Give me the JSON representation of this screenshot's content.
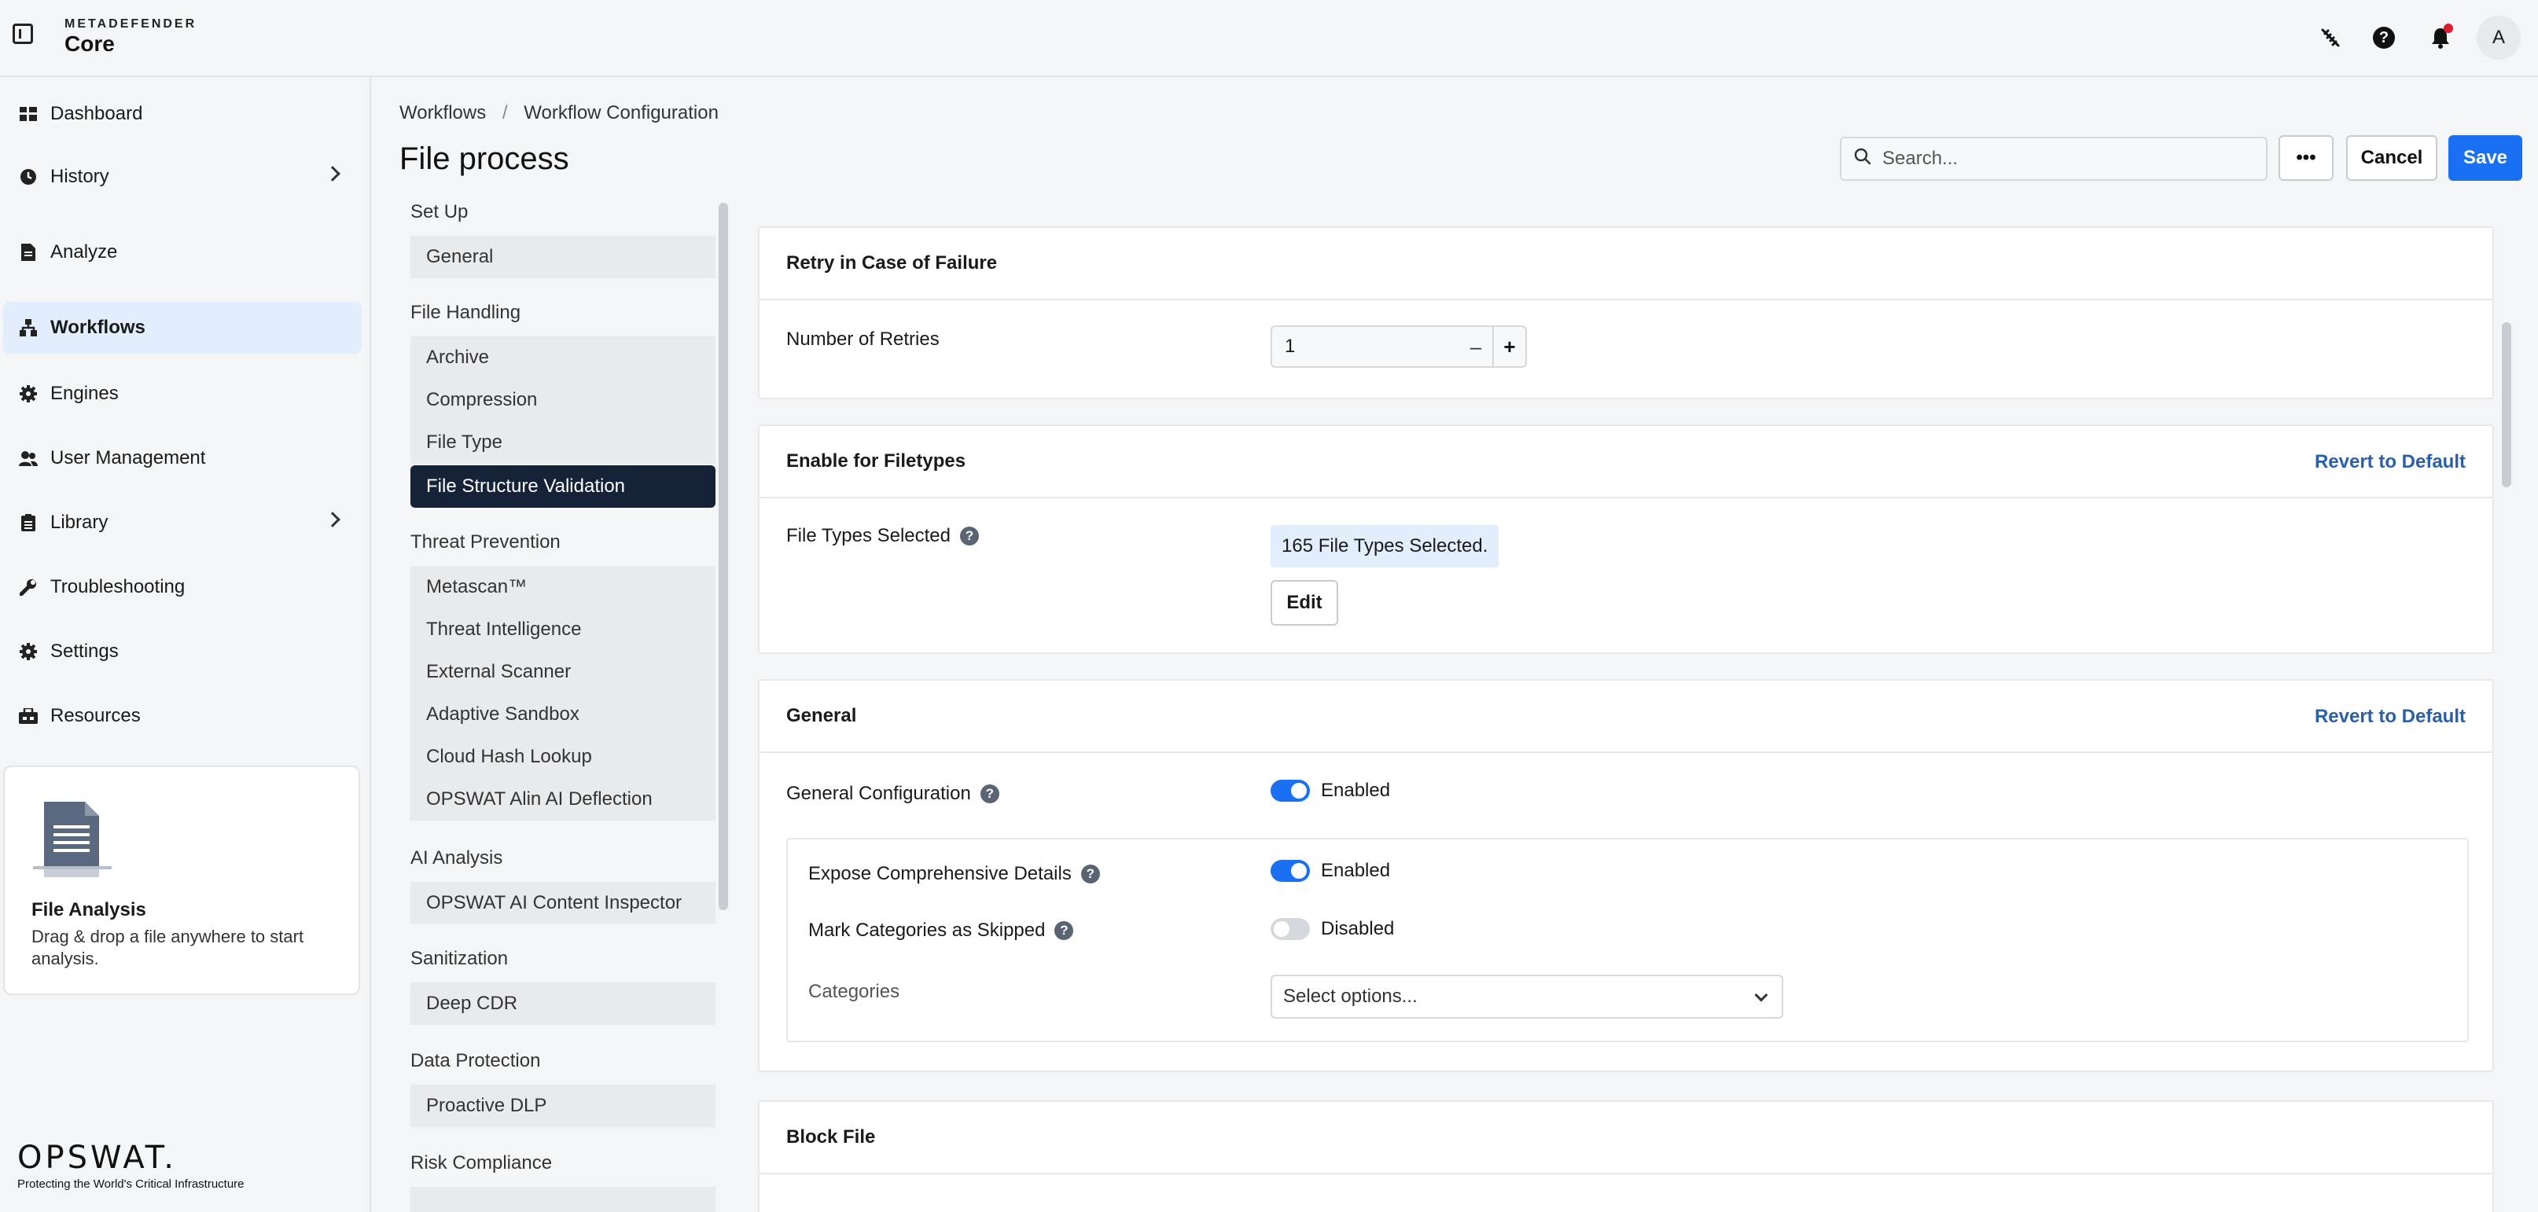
{
  "header": {
    "brand_top": "METADEFENDER",
    "brand_main": "Core",
    "avatar_initial": "A"
  },
  "sidebar": {
    "items": [
      {
        "label": "Dashboard",
        "icon": "dashboard-icon"
      },
      {
        "label": "History",
        "icon": "history-icon",
        "has_submenu": true
      },
      {
        "label": "Analyze",
        "icon": "file-icon"
      },
      {
        "label": "Workflows",
        "icon": "workflow-icon",
        "active": true
      },
      {
        "label": "Engines",
        "icon": "gear-icon"
      },
      {
        "label": "User Management",
        "icon": "users-icon"
      },
      {
        "label": "Library",
        "icon": "library-icon",
        "has_submenu": true
      },
      {
        "label": "Troubleshooting",
        "icon": "wrench-icon"
      },
      {
        "label": "Settings",
        "icon": "gear-icon"
      },
      {
        "label": "Resources",
        "icon": "resources-icon"
      }
    ],
    "file_analysis": {
      "title": "File Analysis",
      "text": "Drag & drop a file anywhere to start analysis."
    },
    "logo_text": "OPSWAT.",
    "logo_tagline": "Protecting the World's Critical Infrastructure"
  },
  "breadcrumb": [
    "Workflows",
    "/",
    "Workflow Configuration"
  ],
  "page_title": "File process",
  "toolbar": {
    "search_placeholder": "Search...",
    "more_label": "•••",
    "cancel_label": "Cancel",
    "save_label": "Save"
  },
  "subnav": {
    "groups": [
      {
        "title": "Set Up",
        "items": [
          "General"
        ]
      },
      {
        "title": "File Handling",
        "items": [
          "Archive",
          "Compression",
          "File Type",
          "File Structure Validation"
        ]
      },
      {
        "title": "Threat Prevention",
        "items": [
          "Metascan™",
          "Threat Intelligence",
          "External Scanner",
          "Adaptive Sandbox",
          "Cloud Hash Lookup",
          "OPSWAT Alin AI Deflection"
        ]
      },
      {
        "title": "AI Analysis",
        "items": [
          "OPSWAT AI Content Inspector"
        ]
      },
      {
        "title": "Sanitization",
        "items": [
          "Deep CDR"
        ]
      },
      {
        "title": "Data Protection",
        "items": [
          "Proactive DLP"
        ]
      },
      {
        "title": "Risk Compliance",
        "items": []
      }
    ],
    "active_item": "File Structure Validation"
  },
  "retry": {
    "title": "Retry in Case of Failure",
    "label": "Number of Retries",
    "value": "1",
    "minus": "–",
    "plus": "+"
  },
  "filetypes": {
    "title": "Enable for Filetypes",
    "revert": "Revert to Default",
    "label": "File Types Selected",
    "chip": "165 File Types Selected.",
    "edit": "Edit"
  },
  "general": {
    "title": "General",
    "revert": "Revert to Default",
    "config_label": "General Configuration",
    "config_state": "Enabled",
    "expose_label": "Expose Comprehensive Details",
    "expose_state": "Enabled",
    "mark_label": "Mark Categories as Skipped",
    "mark_state": "Disabled",
    "categories_label": "Categories",
    "categories_placeholder": "Select options..."
  },
  "block": {
    "title": "Block File"
  },
  "colors": {
    "accent": "#1a6ff2",
    "active_subnav": "#152238",
    "link": "#2b5fa8",
    "notification": "#e0192f"
  }
}
